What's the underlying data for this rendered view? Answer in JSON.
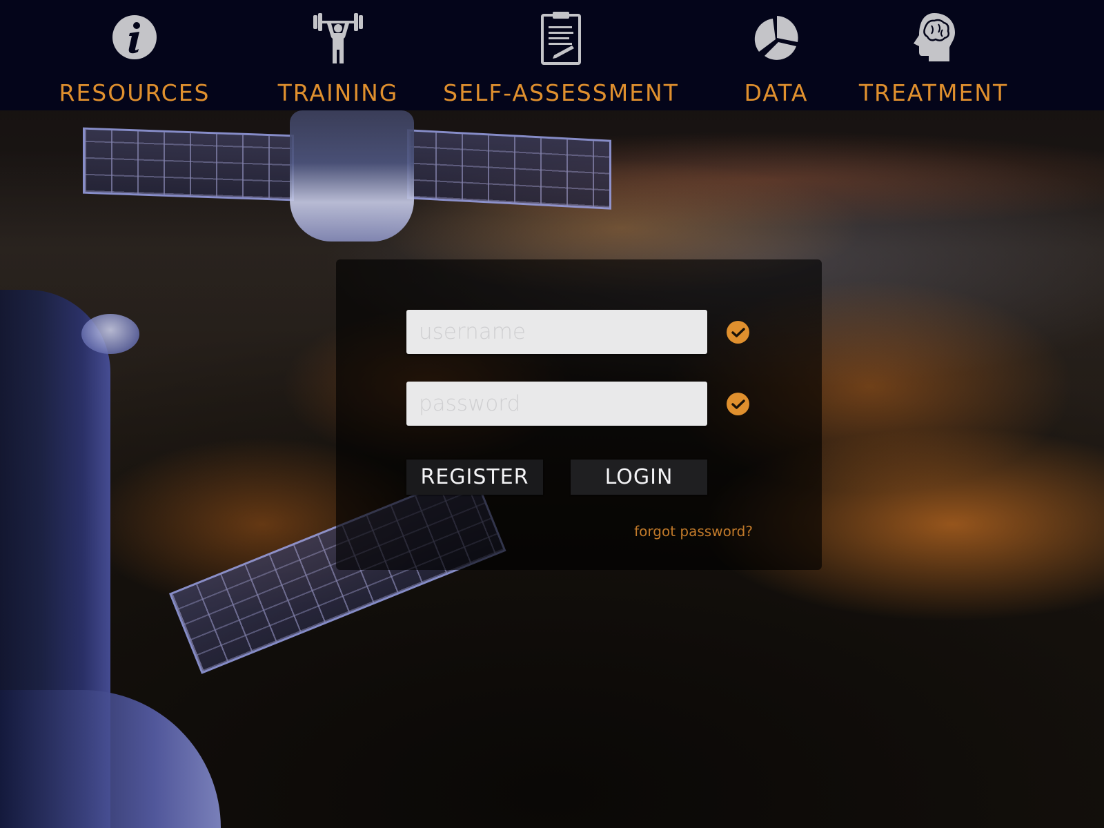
{
  "nav": {
    "items": [
      {
        "label": "RESOURCES",
        "icon": "info-icon"
      },
      {
        "label": "TRAINING",
        "icon": "weightlifter-icon"
      },
      {
        "label": "SELF-ASSESSMENT",
        "icon": "clipboard-icon"
      },
      {
        "label": "DATA",
        "icon": "pie-chart-icon"
      },
      {
        "label": "TREATMENT",
        "icon": "brain-head-icon"
      }
    ]
  },
  "login": {
    "username_placeholder": "username",
    "password_placeholder": "password",
    "register_label": "REGISTER",
    "login_label": "LOGIN",
    "forgot_label": "forgot password?"
  },
  "colors": {
    "accent": "#e0902e",
    "nav_background": "#04051a",
    "icon_gray": "#c4c4c8"
  }
}
